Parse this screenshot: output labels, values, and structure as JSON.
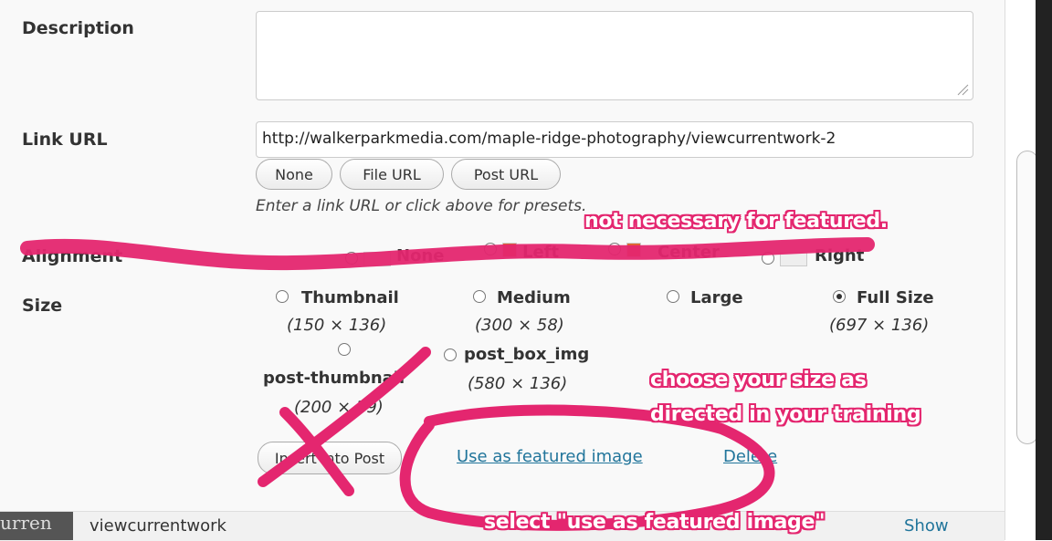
{
  "form": {
    "description_label": "Description",
    "link_url_label": "Link URL",
    "link_url_value": "http://walkerparkmedia.com/maple-ridge-photography/viewcurrentwork-2",
    "buttons": {
      "none": "None",
      "file_url": "File URL",
      "post_url": "Post URL"
    },
    "hint": "Enter a link URL or click above for presets.",
    "alignment_label": "Alignment",
    "alignment_options": [
      "None",
      "Left",
      "Center",
      "Right"
    ],
    "size_label": "Size",
    "sizes": [
      {
        "name": "Thumbnail",
        "dims": "(150 × 136)",
        "checked": false
      },
      {
        "name": "Medium",
        "dims": "(300 × 58)",
        "checked": false
      },
      {
        "name": "Large",
        "dims": "",
        "checked": false
      },
      {
        "name": "Full Size",
        "dims": "(697 × 136)",
        "checked": true
      },
      {
        "name": "post-thumbnail",
        "dims": "(200 × 39)",
        "checked": false
      },
      {
        "name": "post_box_img",
        "dims": "(580 × 136)",
        "checked": false
      }
    ],
    "insert_button": "Insert into Post",
    "featured_link": "Use as featured image",
    "delete_link": "Delete"
  },
  "attachment": {
    "thumb_text": "urren",
    "name": "viewcurrentwork",
    "show_link": "Show"
  },
  "annotations": {
    "not_necessary": "not necessary for featured.",
    "choose_size_line1": "choose your size as",
    "choose_size_line2": "directed in your training",
    "select_featured": "select \"use as featured image\"",
    "color": "#e4266f"
  }
}
